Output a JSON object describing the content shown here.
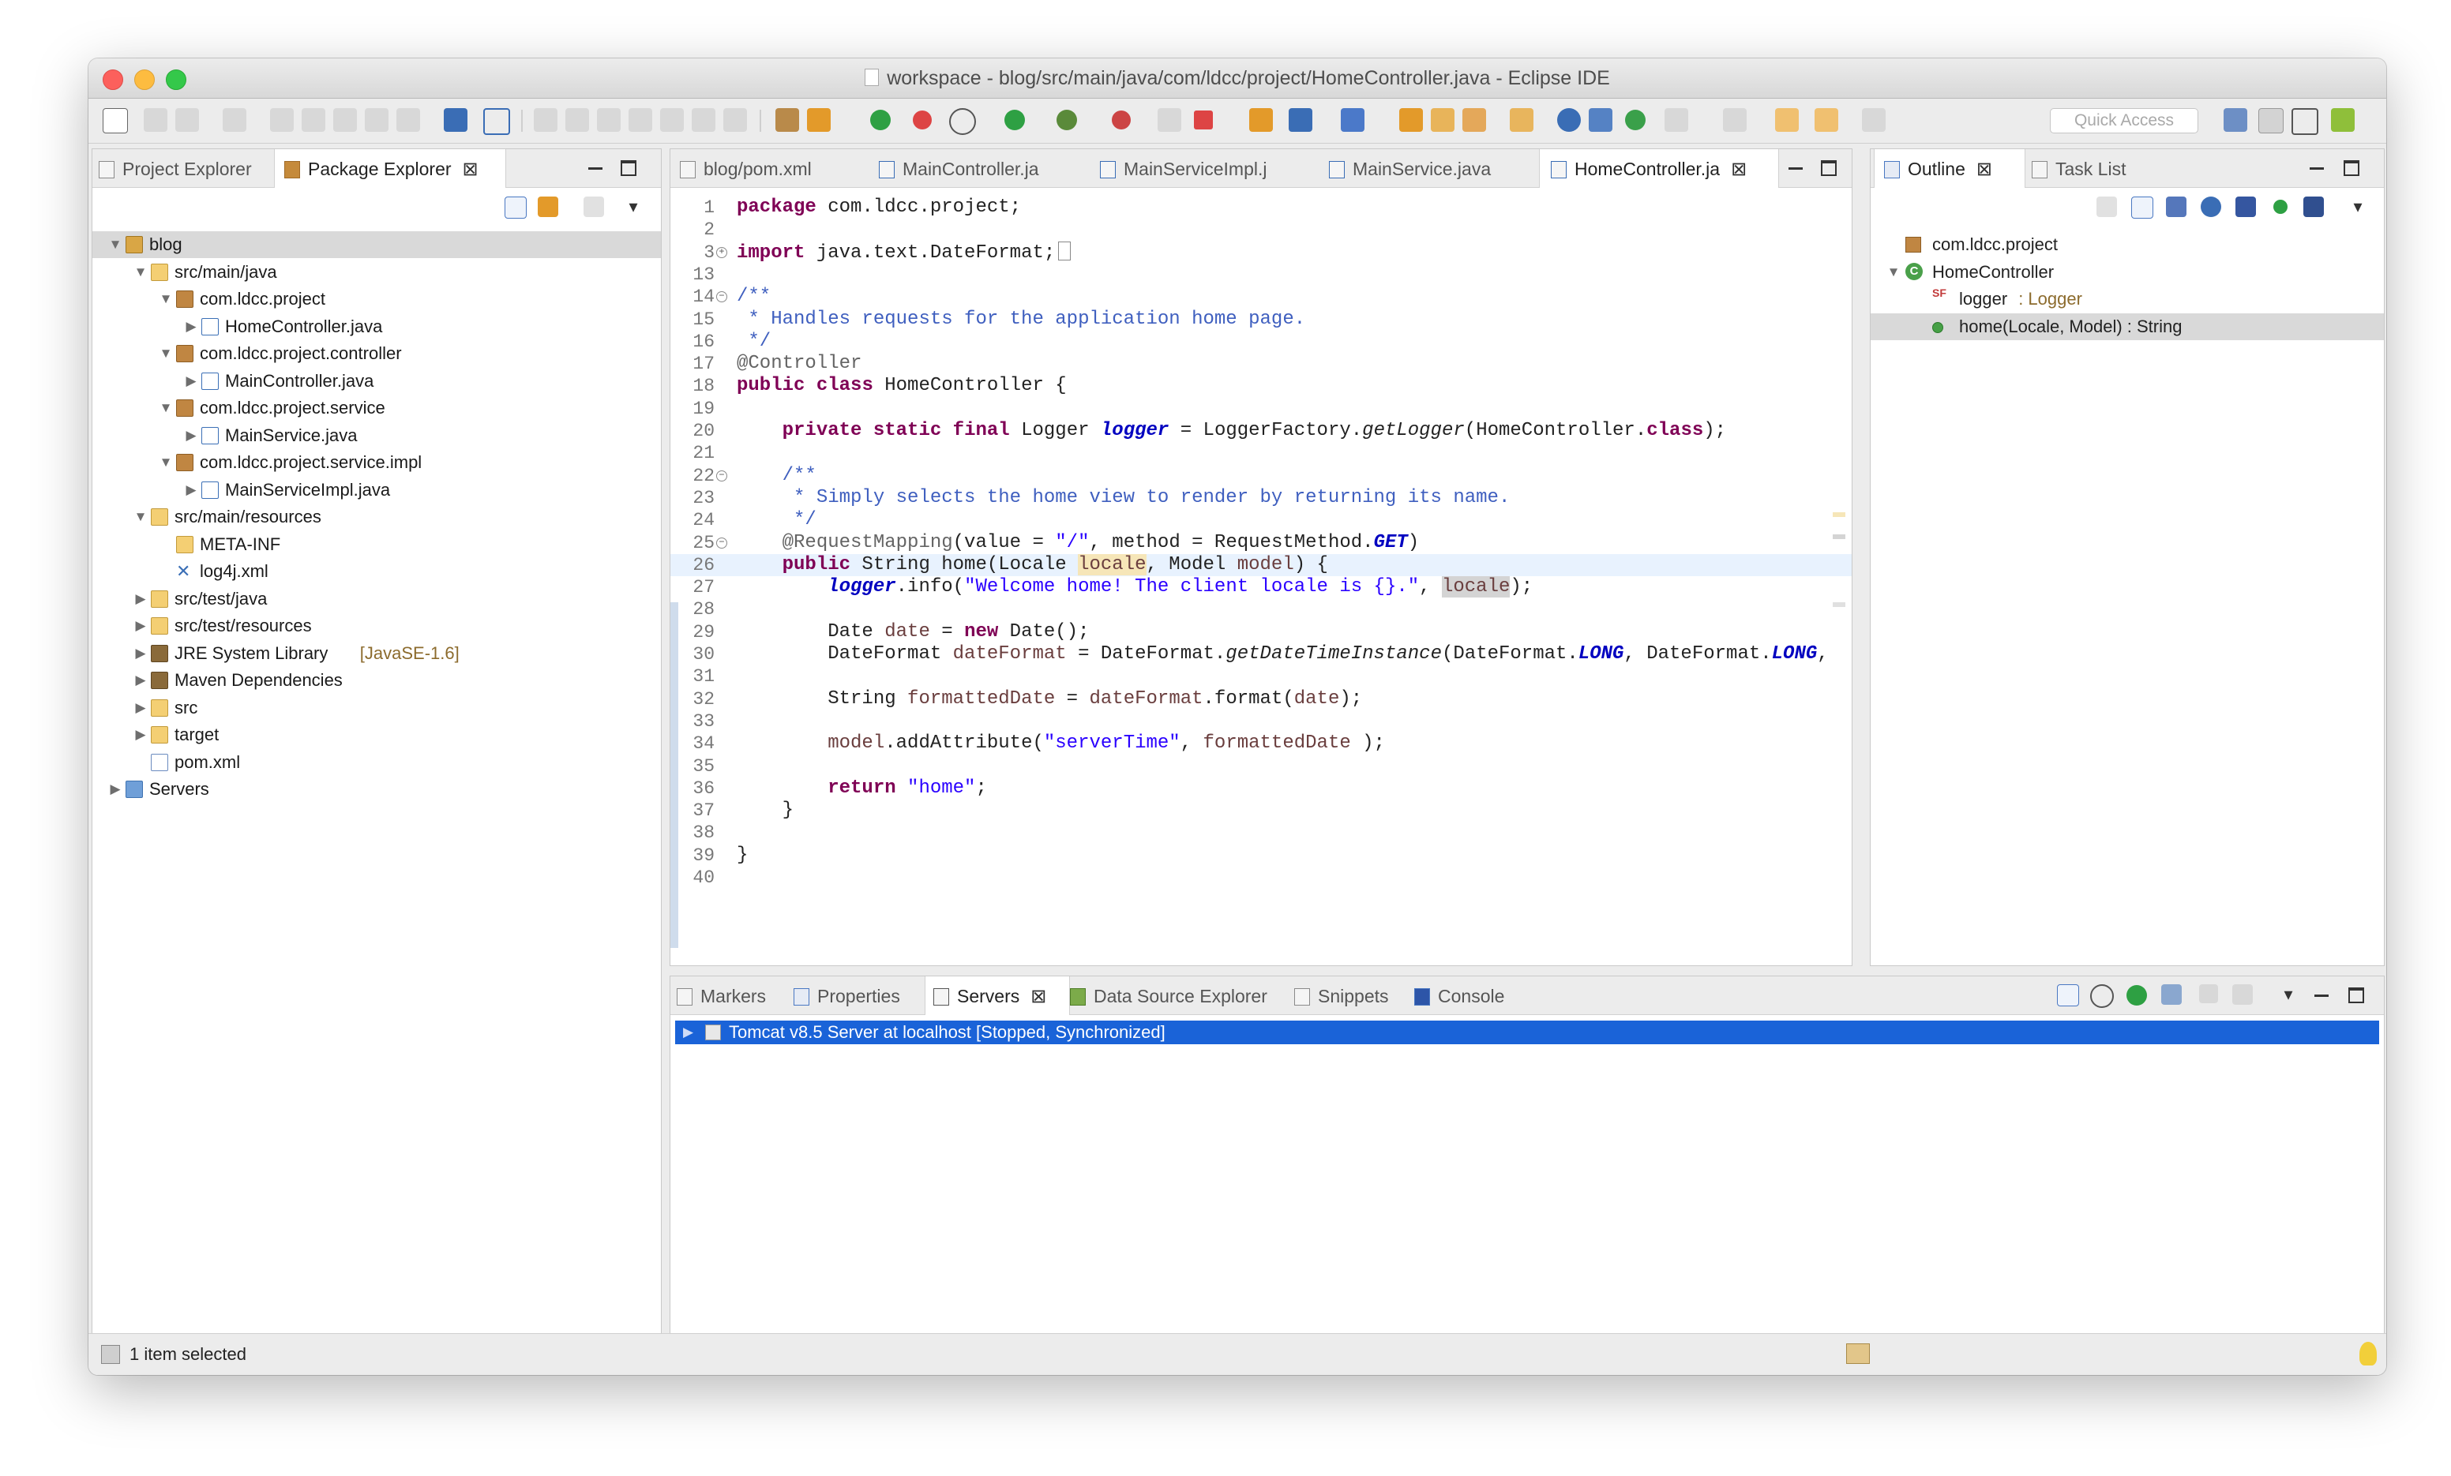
{
  "window": {
    "title": "workspace - blog/src/main/java/com/ldcc/project/HomeController.java - Eclipse IDE",
    "quick_access_placeholder": "Quick Access"
  },
  "left_panel": {
    "tabs": [
      {
        "label": "Project Explorer"
      },
      {
        "label": "Package Explorer"
      }
    ],
    "tree": [
      {
        "label": "blog",
        "indent": 0,
        "icon": "project-icon",
        "expanded": true,
        "selected": true
      },
      {
        "label": "src/main/java",
        "indent": 1,
        "icon": "source-folder-icon",
        "expanded": true
      },
      {
        "label": "com.ldcc.project",
        "indent": 2,
        "icon": "package-icon",
        "expanded": true
      },
      {
        "label": "HomeController.java",
        "indent": 3,
        "icon": "java-file-icon",
        "expanded": false
      },
      {
        "label": "com.ldcc.project.controller",
        "indent": 2,
        "icon": "package-icon",
        "expanded": true
      },
      {
        "label": "MainController.java",
        "indent": 3,
        "icon": "java-file-icon",
        "expanded": false
      },
      {
        "label": "com.ldcc.project.service",
        "indent": 2,
        "icon": "package-icon",
        "expanded": true
      },
      {
        "label": "MainService.java",
        "indent": 3,
        "icon": "java-file-icon",
        "expanded": false
      },
      {
        "label": "com.ldcc.project.service.impl",
        "indent": 2,
        "icon": "package-icon",
        "expanded": true
      },
      {
        "label": "MainServiceImpl.java",
        "indent": 3,
        "icon": "java-file-icon",
        "expanded": false
      },
      {
        "label": "src/main/resources",
        "indent": 1,
        "icon": "source-folder-icon",
        "expanded": true
      },
      {
        "label": "META-INF",
        "indent": 2,
        "icon": "folder-icon",
        "expanded": null
      },
      {
        "label": "log4j.xml",
        "indent": 2,
        "icon": "xml-tool-icon",
        "expanded": null
      },
      {
        "label": "src/test/java",
        "indent": 1,
        "icon": "source-folder-icon",
        "expanded": false
      },
      {
        "label": "src/test/resources",
        "indent": 1,
        "icon": "source-folder-icon",
        "expanded": false
      },
      {
        "label": "JRE System Library",
        "decor": "[JavaSE-1.6]",
        "indent": 1,
        "icon": "library-icon",
        "expanded": false
      },
      {
        "label": "Maven Dependencies",
        "indent": 1,
        "icon": "library-icon",
        "expanded": false
      },
      {
        "label": "src",
        "indent": 1,
        "icon": "source-folder-icon",
        "expanded": false
      },
      {
        "label": "target",
        "indent": 1,
        "icon": "folder-icon",
        "expanded": false
      },
      {
        "label": "pom.xml",
        "indent": 1,
        "icon": "xml-file-icon",
        "expanded": null
      },
      {
        "label": "Servers",
        "indent": 0,
        "icon": "servers-folder-icon",
        "expanded": false
      }
    ]
  },
  "editor": {
    "tabs": [
      {
        "label": "blog/pom.xml"
      },
      {
        "label": "MainController.ja"
      },
      {
        "label": "MainServiceImpl.j"
      },
      {
        "label": "MainService.java"
      },
      {
        "label": "HomeController.ja"
      }
    ],
    "lines": [
      {
        "num": "1",
        "text": "package com.ldcc.project;"
      },
      {
        "num": "2",
        "text": ""
      },
      {
        "num": "3",
        "text": "import java.text.DateFormat;"
      },
      {
        "num": "13",
        "text": ""
      },
      {
        "num": "14",
        "text": "/**"
      },
      {
        "num": "15",
        "text": " * Handles requests for the application home page."
      },
      {
        "num": "16",
        "text": " */"
      },
      {
        "num": "17",
        "text": "@Controller"
      },
      {
        "num": "18",
        "text": "public class HomeController {"
      },
      {
        "num": "19",
        "text": ""
      },
      {
        "num": "20",
        "text": "    private static final Logger logger = LoggerFactory.getLogger(HomeController.class);"
      },
      {
        "num": "21",
        "text": ""
      },
      {
        "num": "22",
        "text": "    /**"
      },
      {
        "num": "23",
        "text": "     * Simply selects the home view to render by returning its name."
      },
      {
        "num": "24",
        "text": "     */"
      },
      {
        "num": "25",
        "text": "    @RequestMapping(value = \"/\", method = RequestMethod.GET)"
      },
      {
        "num": "26",
        "text": "    public String home(Locale locale, Model model) {"
      },
      {
        "num": "27",
        "text": "        logger.info(\"Welcome home! The client locale is {}.\", locale);"
      },
      {
        "num": "28",
        "text": ""
      },
      {
        "num": "29",
        "text": "        Date date = new Date();"
      },
      {
        "num": "30",
        "text": "        DateFormat dateFormat = DateFormat.getDateTimeInstance(DateFormat.LONG, DateFormat.LONG,"
      },
      {
        "num": "31",
        "text": ""
      },
      {
        "num": "32",
        "text": "        String formattedDate = dateFormat.format(date);"
      },
      {
        "num": "33",
        "text": ""
      },
      {
        "num": "34",
        "text": "        model.addAttribute(\"serverTime\", formattedDate );"
      },
      {
        "num": "35",
        "text": ""
      },
      {
        "num": "36",
        "text": "        return \"home\";"
      },
      {
        "num": "37",
        "text": "    }"
      },
      {
        "num": "38",
        "text": ""
      },
      {
        "num": "39",
        "text": "}"
      },
      {
        "num": "40",
        "text": ""
      }
    ]
  },
  "outline": {
    "tabs": [
      {
        "label": "Outline"
      },
      {
        "label": "Task List"
      }
    ],
    "items": [
      {
        "label": "com.ldcc.project",
        "indent": 0,
        "icon": "package-declaration-icon"
      },
      {
        "label": "HomeController",
        "indent": 0,
        "icon": "class-icon",
        "expanded": true
      },
      {
        "label": "logger",
        "type": " : Logger",
        "indent": 1,
        "icon": "static-final-field-icon"
      },
      {
        "label": "home(Locale, Model) : String",
        "indent": 1,
        "icon": "public-method-icon",
        "selected": true
      }
    ]
  },
  "bottom_panel": {
    "tabs": [
      {
        "label": "Markers"
      },
      {
        "label": "Properties"
      },
      {
        "label": "Servers"
      },
      {
        "label": "Data Source Explorer"
      },
      {
        "label": "Snippets"
      },
      {
        "label": "Console"
      }
    ],
    "server_row": "Tomcat v8.5 Server at localhost  [Stopped, Synchronized]"
  },
  "status_bar": {
    "text": "1 item selected"
  },
  "colors": {
    "selection_blue": "#1a63d8",
    "keyword": "#7f0055",
    "comment": "#3f5fbf",
    "string": "#2a00ff",
    "field": "#0000c0"
  }
}
